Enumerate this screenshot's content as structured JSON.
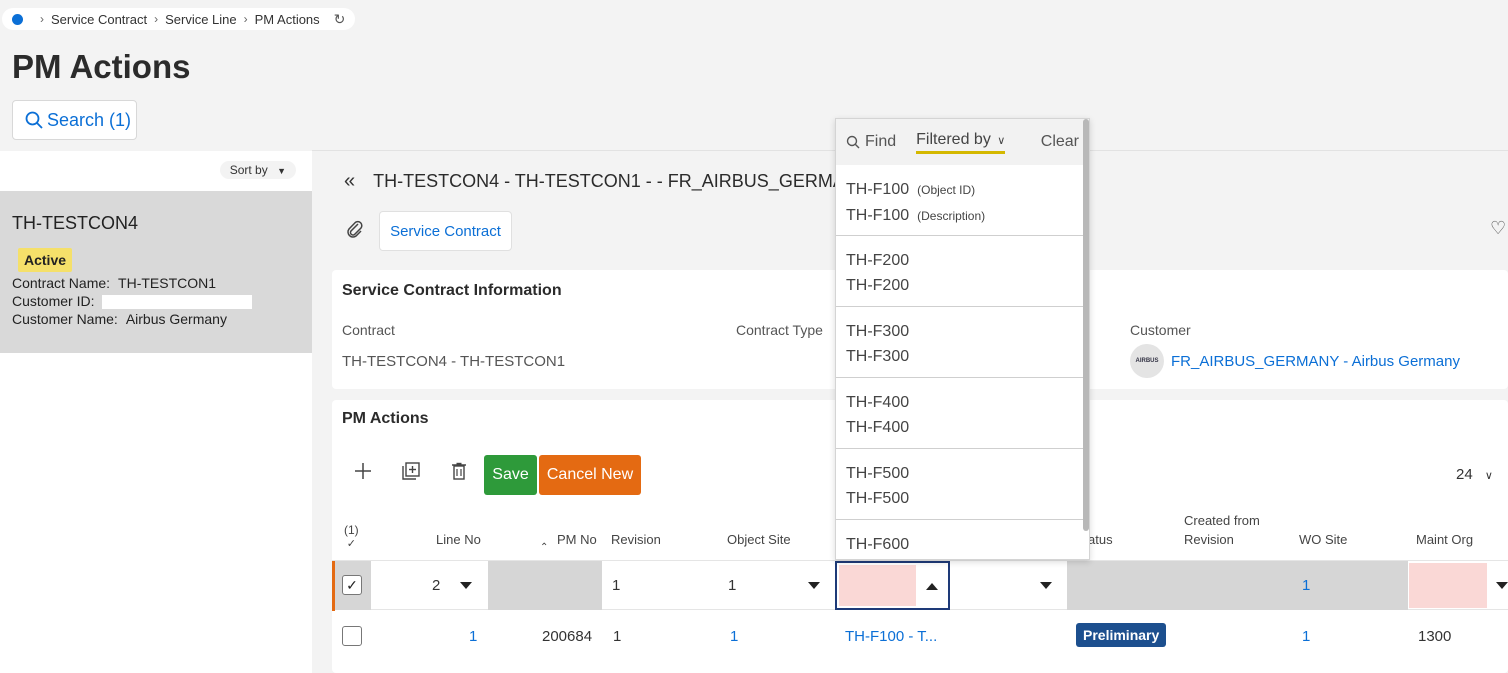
{
  "breadcrumb": {
    "items": [
      "Service Contract",
      "Service Line",
      "PM Actions"
    ]
  },
  "page": {
    "title": "PM Actions"
  },
  "search": {
    "label": "Search (1)"
  },
  "left": {
    "sort_label": "Sort by",
    "card": {
      "title": "TH-TESTCON4",
      "status": "Active",
      "contract_name_label": "Contract Name:",
      "contract_name": "TH-TESTCON1",
      "customer_id_label": "Customer ID:",
      "customer_name_label": "Customer Name:",
      "customer_name": "Airbus Germany"
    }
  },
  "record": {
    "title": "TH-TESTCON4 - TH-TESTCON1 - - FR_AIRBUS_GERMANY",
    "service_contract_btn": "Service Contract"
  },
  "info": {
    "title": "Service Contract Information",
    "contract_label": "Contract",
    "contract_value": "TH-TESTCON4 - TH-TESTCON1",
    "contract_type_label": "Contract Type",
    "customer_label": "Customer",
    "customer_value": "FR_AIRBUS_GERMANY - Airbus Germany",
    "customer_avatar": "AIRBUS"
  },
  "pm": {
    "title": "PM Actions",
    "save": "Save",
    "cancel_new": "Cancel New",
    "page_size": "24",
    "selected_count": "(1)",
    "columns": {
      "line_no": "Line No",
      "pm_no": "PM No",
      "revision": "Revision",
      "object_site": "Object Site",
      "status": "atus",
      "created_from_1": "Created from",
      "created_from_2": "Revision",
      "wo_site": "WO Site",
      "maint_org": "Maint Org"
    },
    "edit_row": {
      "line_no": "2",
      "revision": "1",
      "object_site": "1",
      "wo_site": "1"
    },
    "data_row": {
      "line_no": "1",
      "pm_no": "200684",
      "revision": "1",
      "object_site": "1",
      "object_id": "TH-F100 - T...",
      "status": "Preliminary",
      "wo_site": "1",
      "maint_org": "1300"
    }
  },
  "dropdown": {
    "find": "Find",
    "filtered_by": "Filtered by",
    "clear": "Clear",
    "items": [
      {
        "line1": "TH-F100",
        "sub1": "(Object ID)",
        "line2": "TH-F100",
        "sub2": "(Description)"
      },
      {
        "line1": "TH-F200",
        "line2": "TH-F200"
      },
      {
        "line1": "TH-F300",
        "line2": "TH-F300"
      },
      {
        "line1": "TH-F400",
        "line2": "TH-F400"
      },
      {
        "line1": "TH-F500",
        "line2": "TH-F500"
      },
      {
        "line1": "TH-F600",
        "line2": ""
      }
    ]
  },
  "colors": {
    "accent_blue": "#0b6fd6",
    "save_green": "#2e9a3a",
    "cancel_orange": "#e46a12",
    "active_yellow": "#f5e06a",
    "prelim_navy": "#1c4f8e"
  }
}
